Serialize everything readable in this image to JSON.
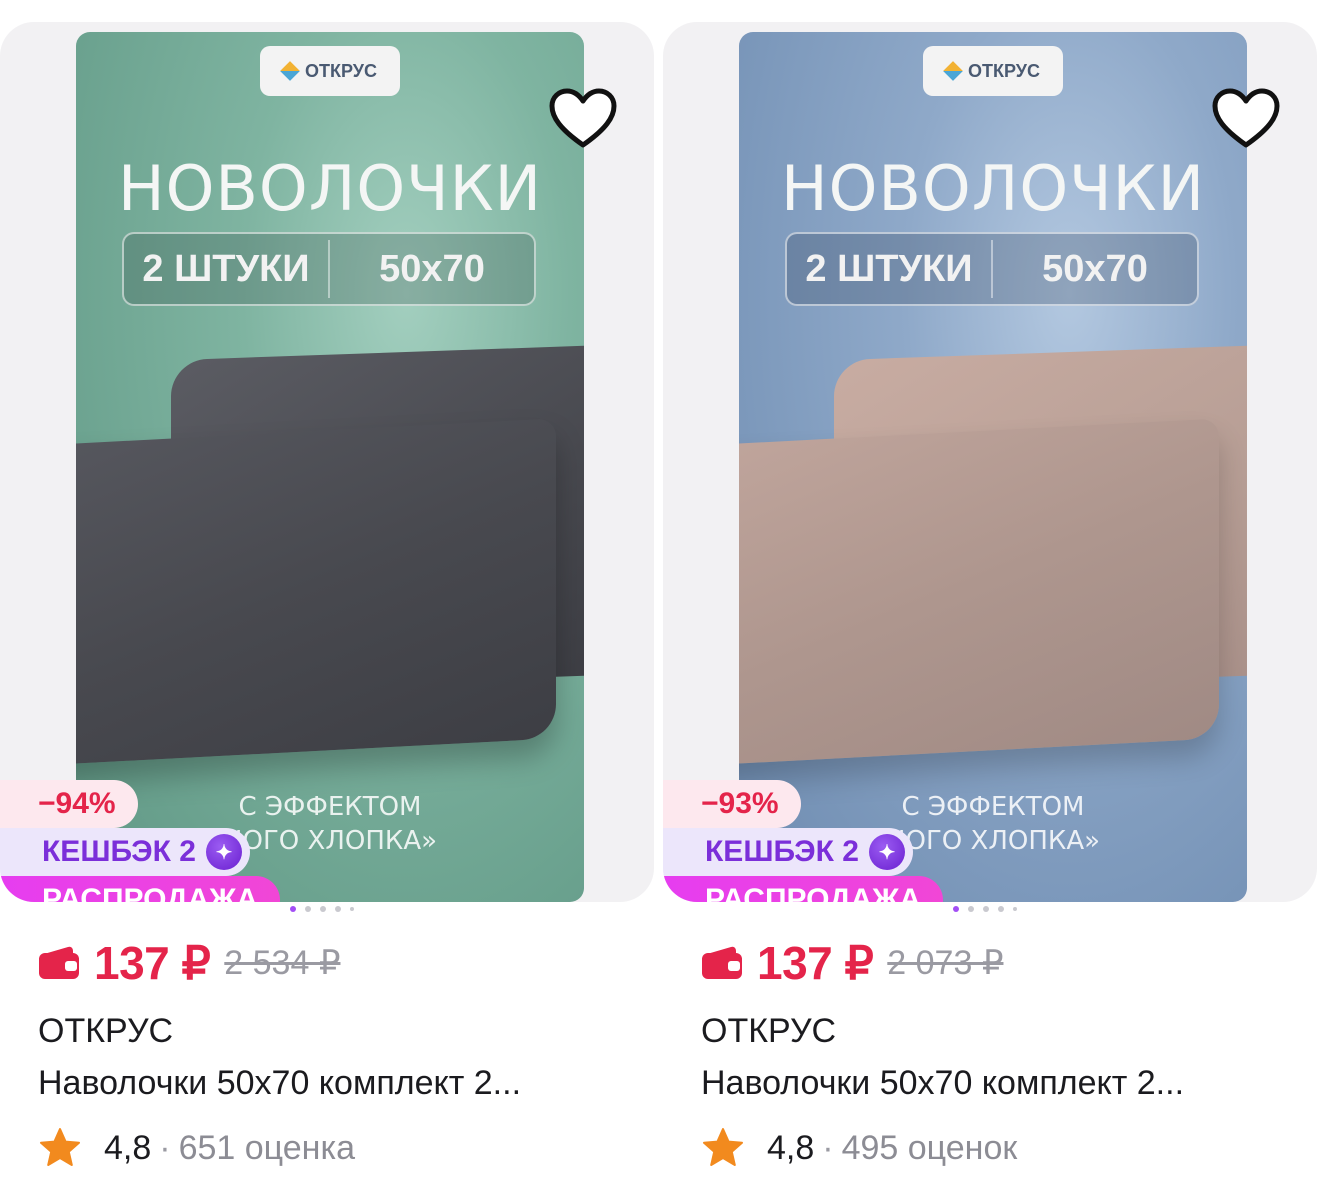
{
  "products": [
    {
      "poster": {
        "brand": "ОТКРУС",
        "title": "НОВОЛОЧКИ",
        "qty": "2 ШТУКИ",
        "size": "50х70",
        "foot_line1": "С ЭФФЕКТОМ",
        "foot_line2": "НОГО ХЛОПКА»",
        "theme": "green"
      },
      "favorite_icon": "heart-outline-icon",
      "discount": "−94%",
      "cashback_label": "КЕШБЭК 2",
      "sale_label": "РАСПРОДАЖА",
      "price": "137 ₽",
      "old_price": "2 534 ₽",
      "brand": "ОТКРУС",
      "title": "Наволочки 50х70 комплект 2...",
      "rating": "4,8",
      "separator": "·",
      "reviews": "651 оценка"
    },
    {
      "poster": {
        "brand": "ОТКРУС",
        "title": "НОВОЛОЧКИ",
        "qty": "2 ШТУКИ",
        "size": "50х70",
        "foot_line1": "С ЭФФЕКТОМ",
        "foot_line2": "НОГО ХЛОПКА»",
        "theme": "blue"
      },
      "favorite_icon": "heart-outline-icon",
      "discount": "−93%",
      "cashback_label": "КЕШБЭК 2",
      "sale_label": "РАСПРОДАЖА",
      "price": "137 ₽",
      "old_price": "2 073 ₽",
      "brand": "ОТКРУС",
      "title": "Наволочки 50х70 комплект 2...",
      "rating": "4,8",
      "separator": "·",
      "reviews": "495 оценок"
    }
  ],
  "colors": {
    "price_red": "#e4244a",
    "cashback_purple": "#7b2fd9",
    "sale_pink": "#e63df0",
    "rating_star": "#f28a1e",
    "carousel_active": "#a34ef5"
  }
}
